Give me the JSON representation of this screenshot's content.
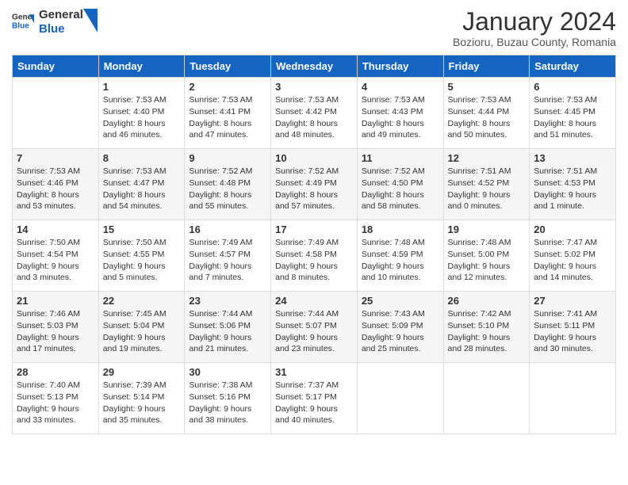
{
  "header": {
    "logo_text_general": "General",
    "logo_text_blue": "Blue",
    "month_title": "January 2024",
    "subtitle": "Bozioru, Buzau County, Romania"
  },
  "days_of_week": [
    "Sunday",
    "Monday",
    "Tuesday",
    "Wednesday",
    "Thursday",
    "Friday",
    "Saturday"
  ],
  "weeks": [
    [
      {
        "day": "",
        "sunrise": "",
        "sunset": "",
        "daylight": ""
      },
      {
        "day": "1",
        "sunrise": "Sunrise: 7:53 AM",
        "sunset": "Sunset: 4:40 PM",
        "daylight": "Daylight: 8 hours and 46 minutes."
      },
      {
        "day": "2",
        "sunrise": "Sunrise: 7:53 AM",
        "sunset": "Sunset: 4:41 PM",
        "daylight": "Daylight: 8 hours and 47 minutes."
      },
      {
        "day": "3",
        "sunrise": "Sunrise: 7:53 AM",
        "sunset": "Sunset: 4:42 PM",
        "daylight": "Daylight: 8 hours and 48 minutes."
      },
      {
        "day": "4",
        "sunrise": "Sunrise: 7:53 AM",
        "sunset": "Sunset: 4:43 PM",
        "daylight": "Daylight: 8 hours and 49 minutes."
      },
      {
        "day": "5",
        "sunrise": "Sunrise: 7:53 AM",
        "sunset": "Sunset: 4:44 PM",
        "daylight": "Daylight: 8 hours and 50 minutes."
      },
      {
        "day": "6",
        "sunrise": "Sunrise: 7:53 AM",
        "sunset": "Sunset: 4:45 PM",
        "daylight": "Daylight: 8 hours and 51 minutes."
      }
    ],
    [
      {
        "day": "7",
        "sunrise": "Sunrise: 7:53 AM",
        "sunset": "Sunset: 4:46 PM",
        "daylight": "Daylight: 8 hours and 53 minutes."
      },
      {
        "day": "8",
        "sunrise": "Sunrise: 7:53 AM",
        "sunset": "Sunset: 4:47 PM",
        "daylight": "Daylight: 8 hours and 54 minutes."
      },
      {
        "day": "9",
        "sunrise": "Sunrise: 7:52 AM",
        "sunset": "Sunset: 4:48 PM",
        "daylight": "Daylight: 8 hours and 55 minutes."
      },
      {
        "day": "10",
        "sunrise": "Sunrise: 7:52 AM",
        "sunset": "Sunset: 4:49 PM",
        "daylight": "Daylight: 8 hours and 57 minutes."
      },
      {
        "day": "11",
        "sunrise": "Sunrise: 7:52 AM",
        "sunset": "Sunset: 4:50 PM",
        "daylight": "Daylight: 8 hours and 58 minutes."
      },
      {
        "day": "12",
        "sunrise": "Sunrise: 7:51 AM",
        "sunset": "Sunset: 4:52 PM",
        "daylight": "Daylight: 9 hours and 0 minutes."
      },
      {
        "day": "13",
        "sunrise": "Sunrise: 7:51 AM",
        "sunset": "Sunset: 4:53 PM",
        "daylight": "Daylight: 9 hours and 1 minute."
      }
    ],
    [
      {
        "day": "14",
        "sunrise": "Sunrise: 7:50 AM",
        "sunset": "Sunset: 4:54 PM",
        "daylight": "Daylight: 9 hours and 3 minutes."
      },
      {
        "day": "15",
        "sunrise": "Sunrise: 7:50 AM",
        "sunset": "Sunset: 4:55 PM",
        "daylight": "Daylight: 9 hours and 5 minutes."
      },
      {
        "day": "16",
        "sunrise": "Sunrise: 7:49 AM",
        "sunset": "Sunset: 4:57 PM",
        "daylight": "Daylight: 9 hours and 7 minutes."
      },
      {
        "day": "17",
        "sunrise": "Sunrise: 7:49 AM",
        "sunset": "Sunset: 4:58 PM",
        "daylight": "Daylight: 9 hours and 8 minutes."
      },
      {
        "day": "18",
        "sunrise": "Sunrise: 7:48 AM",
        "sunset": "Sunset: 4:59 PM",
        "daylight": "Daylight: 9 hours and 10 minutes."
      },
      {
        "day": "19",
        "sunrise": "Sunrise: 7:48 AM",
        "sunset": "Sunset: 5:00 PM",
        "daylight": "Daylight: 9 hours and 12 minutes."
      },
      {
        "day": "20",
        "sunrise": "Sunrise: 7:47 AM",
        "sunset": "Sunset: 5:02 PM",
        "daylight": "Daylight: 9 hours and 14 minutes."
      }
    ],
    [
      {
        "day": "21",
        "sunrise": "Sunrise: 7:46 AM",
        "sunset": "Sunset: 5:03 PM",
        "daylight": "Daylight: 9 hours and 17 minutes."
      },
      {
        "day": "22",
        "sunrise": "Sunrise: 7:45 AM",
        "sunset": "Sunset: 5:04 PM",
        "daylight": "Daylight: 9 hours and 19 minutes."
      },
      {
        "day": "23",
        "sunrise": "Sunrise: 7:44 AM",
        "sunset": "Sunset: 5:06 PM",
        "daylight": "Daylight: 9 hours and 21 minutes."
      },
      {
        "day": "24",
        "sunrise": "Sunrise: 7:44 AM",
        "sunset": "Sunset: 5:07 PM",
        "daylight": "Daylight: 9 hours and 23 minutes."
      },
      {
        "day": "25",
        "sunrise": "Sunrise: 7:43 AM",
        "sunset": "Sunset: 5:09 PM",
        "daylight": "Daylight: 9 hours and 25 minutes."
      },
      {
        "day": "26",
        "sunrise": "Sunrise: 7:42 AM",
        "sunset": "Sunset: 5:10 PM",
        "daylight": "Daylight: 9 hours and 28 minutes."
      },
      {
        "day": "27",
        "sunrise": "Sunrise: 7:41 AM",
        "sunset": "Sunset: 5:11 PM",
        "daylight": "Daylight: 9 hours and 30 minutes."
      }
    ],
    [
      {
        "day": "28",
        "sunrise": "Sunrise: 7:40 AM",
        "sunset": "Sunset: 5:13 PM",
        "daylight": "Daylight: 9 hours and 33 minutes."
      },
      {
        "day": "29",
        "sunrise": "Sunrise: 7:39 AM",
        "sunset": "Sunset: 5:14 PM",
        "daylight": "Daylight: 9 hours and 35 minutes."
      },
      {
        "day": "30",
        "sunrise": "Sunrise: 7:38 AM",
        "sunset": "Sunset: 5:16 PM",
        "daylight": "Daylight: 9 hours and 38 minutes."
      },
      {
        "day": "31",
        "sunrise": "Sunrise: 7:37 AM",
        "sunset": "Sunset: 5:17 PM",
        "daylight": "Daylight: 9 hours and 40 minutes."
      },
      {
        "day": "",
        "sunrise": "",
        "sunset": "",
        "daylight": ""
      },
      {
        "day": "",
        "sunrise": "",
        "sunset": "",
        "daylight": ""
      },
      {
        "day": "",
        "sunrise": "",
        "sunset": "",
        "daylight": ""
      }
    ]
  ]
}
